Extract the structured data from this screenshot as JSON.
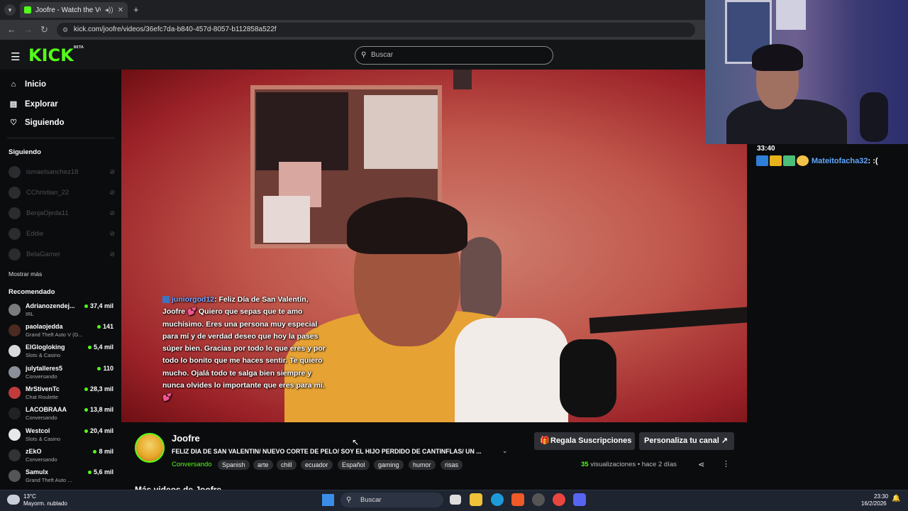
{
  "browser": {
    "tab_title": "Joofre - Watch the VOD on",
    "url": "kick.com/joofre/videos/36efc7da-b840-457d-8057-b112858a522f"
  },
  "header": {
    "logo": "KICK",
    "logo_badge": "BETA",
    "search_placeholder": "Buscar"
  },
  "sidebar": {
    "nav": [
      {
        "label": "Inicio",
        "icon": "home-icon"
      },
      {
        "label": "Explorar",
        "icon": "compass-icon"
      },
      {
        "label": "Siguiendo",
        "icon": "heart-icon"
      }
    ],
    "following_header": "Siguiendo",
    "following": [
      "ismaelsanchez18",
      "CChristian_22",
      "BenjaOjeda11",
      "Eddie",
      "BelaGamer"
    ],
    "show_more": "Mostrar más",
    "recommended_header": "Recomendado",
    "recommended": [
      {
        "name": "Adrianozendej...",
        "category": "IRL",
        "viewers": "37,4 mil"
      },
      {
        "name": "paolaojedda",
        "category": "Grand Theft Auto V (G...",
        "viewers": "141"
      },
      {
        "name": "ElGlogloking",
        "category": "Slots & Casino",
        "viewers": "5,4 mil"
      },
      {
        "name": "julytalleres5",
        "category": "Conversando",
        "viewers": "110"
      },
      {
        "name": "MrStivenTc",
        "category": "Chat Roulette",
        "viewers": "28,3 mil"
      },
      {
        "name": "LACOBRAAA",
        "category": "Conversando",
        "viewers": "13,8 mil"
      },
      {
        "name": "Westcol",
        "category": "Slots & Casino",
        "viewers": "20,4 mil"
      },
      {
        "name": "zEkO",
        "category": "Conversando",
        "viewers": "8 mil"
      },
      {
        "name": "Samulx",
        "category": "Grand Theft Auto ...",
        "viewers": "5,6 mil"
      }
    ]
  },
  "video_overlay": {
    "chat_user": "juniorgod12",
    "chat_message": ": Feliz Día de San Valentín, Joofre 💕 Quiero que sepas que te amo muchísimo. Eres una persona muy especial para mí y de verdad deseo que hoy la pases súper bien. Gracias por todo lo que eres y por todo lo bonito que me haces sentir. Te quiero mucho. Ojalá todo te salga bien siempre y nunca olvides lo importante que eres para mí. 💕"
  },
  "webcam_chat": {
    "time": "33:40",
    "user": "Mateitofacha32",
    "message": ": :("
  },
  "channel": {
    "name": "Joofre",
    "title": "FELIZ DIA DE SAN VALENTIN/ NUEVO CORTE DE PELO/ SOY EL HIJO PERDIDO DE CANTINFLAS/ UN ...",
    "category": "Conversando",
    "tags": [
      "Spanish",
      "arte",
      "chill",
      "ecuador",
      "Español",
      "gaming",
      "humor",
      "risas"
    ],
    "gift_button": "Regala Suscripciones",
    "customize_button": "Personaliza tu canal",
    "views_count": "35",
    "views_label": "visualizaciones",
    "dot": "•",
    "age": "hace 2 días",
    "more_videos": "Más videos de Joofre"
  },
  "taskbar": {
    "weather_temp": "13°C",
    "weather_desc": "Mayorm. nublado",
    "search": "Buscar",
    "time": "23:30",
    "date": "16/2/2026"
  }
}
